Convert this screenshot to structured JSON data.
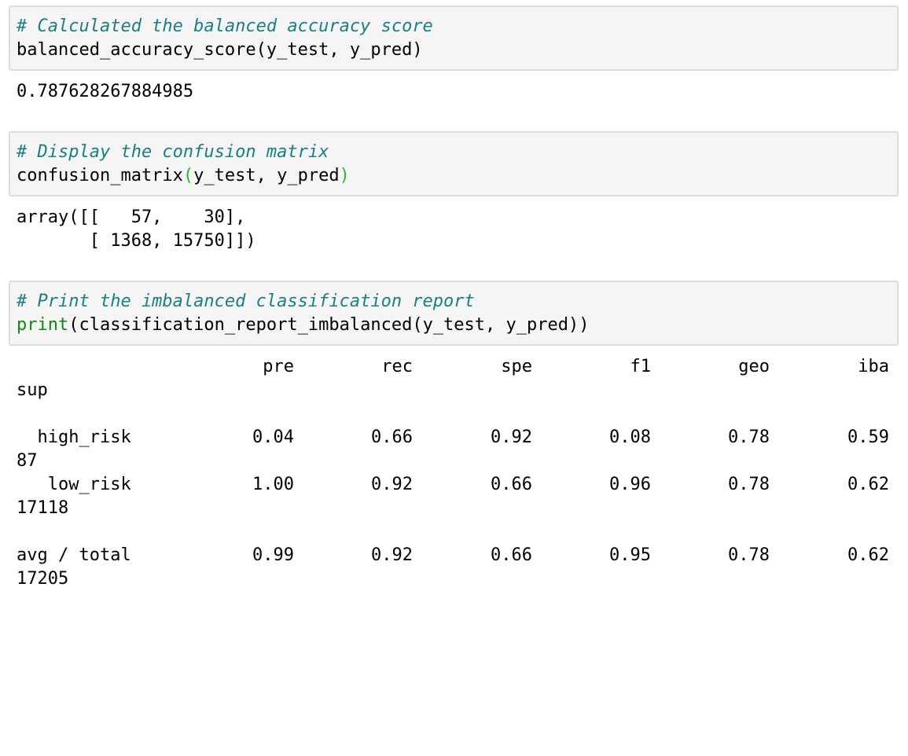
{
  "cells": [
    {
      "comment": "# Calculated the balanced accuracy score",
      "code": "balanced_accuracy_score(y_test, y_pred)",
      "output": [
        "0.787628267884985"
      ]
    },
    {
      "comment": "# Display the confusion matrix",
      "code_func": "confusion_matrix",
      "code_open": "(",
      "code_args": "y_test, y_pred",
      "code_close": ")",
      "output": [
        "array([[   57,    30],",
        "       [ 1368, 15750]])"
      ]
    },
    {
      "comment": "# Print the imbalanced classification report",
      "code_builtin": "print",
      "code_rest": "(classification_report_imbalanced(y_test, y_pred))"
    }
  ],
  "report": {
    "headers": [
      "pre",
      "rec",
      "spe",
      "f1",
      "geo",
      "iba"
    ],
    "sup_header": "sup",
    "rows": [
      {
        "label": "  high_risk",
        "values": [
          "0.04",
          "0.66",
          "0.92",
          "0.08",
          "0.78",
          "0.59"
        ],
        "sup": "87"
      },
      {
        "label": "   low_risk",
        "values": [
          "1.00",
          "0.92",
          "0.66",
          "0.96",
          "0.78",
          "0.62"
        ],
        "sup": "17118"
      },
      {
        "label": "avg / total",
        "values": [
          "0.99",
          "0.92",
          "0.66",
          "0.95",
          "0.78",
          "0.62"
        ],
        "sup": "17205"
      }
    ]
  }
}
